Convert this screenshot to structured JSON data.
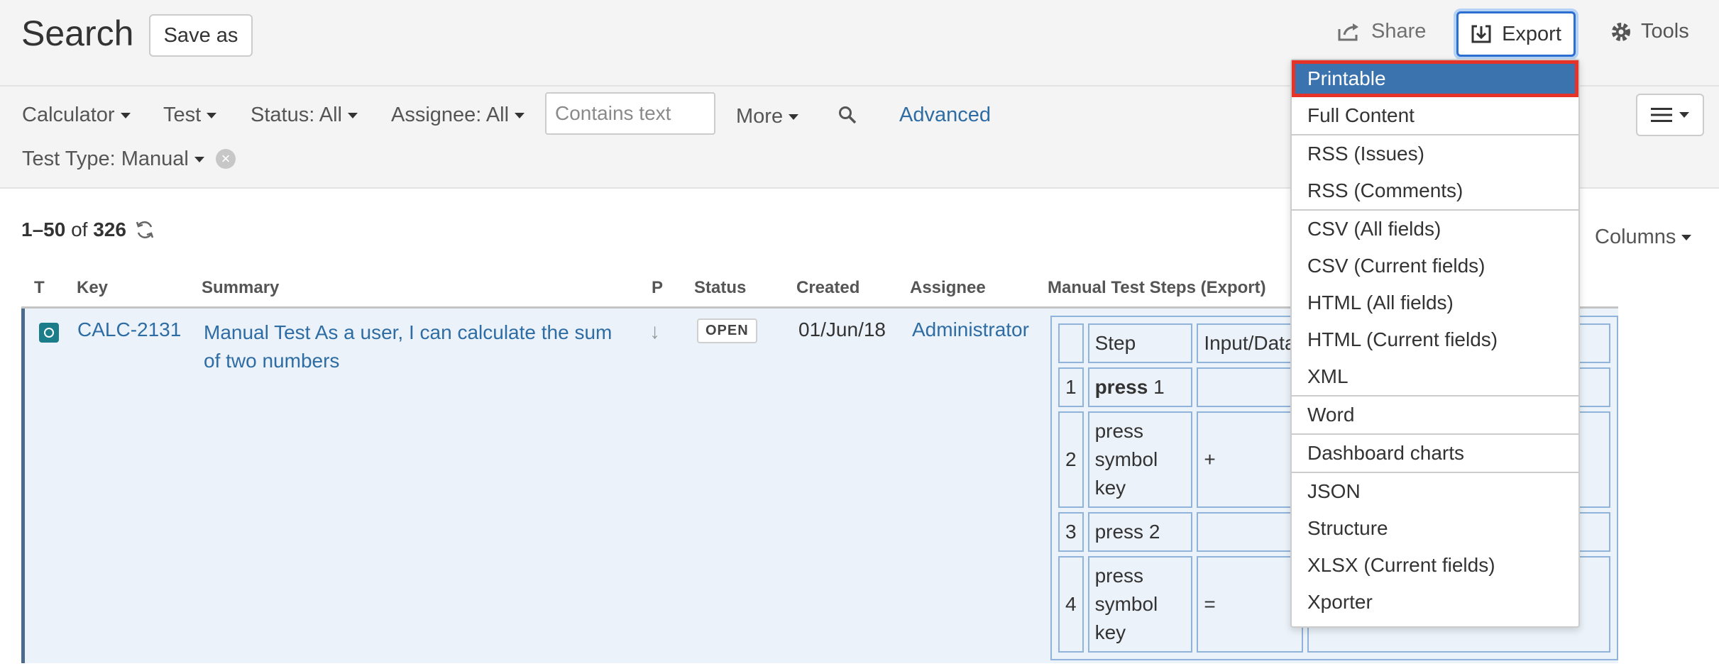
{
  "header": {
    "title": "Search",
    "save_as_label": "Save as",
    "share_label": "Share",
    "export_label": "Export",
    "tools_label": "Tools"
  },
  "filters": {
    "project": "Calculator",
    "type": "Test",
    "status": "Status: All",
    "assignee": "Assignee: All",
    "text_placeholder": "Contains text",
    "more": "More",
    "advanced": "Advanced",
    "test_type": "Test Type: Manual"
  },
  "results": {
    "range": "1–50",
    "of": "of",
    "total": "326",
    "columns_label": "Columns"
  },
  "table": {
    "headers": [
      "T",
      "Key",
      "Summary",
      "P",
      "Status",
      "Created",
      "Assignee",
      "Manual Test Steps (Export)"
    ],
    "row": {
      "key": "CALC-2131",
      "summary": "Manual Test As a user, I can calculate the sum of two numbers",
      "status": "OPEN",
      "created": "01/Jun/18",
      "assignee": "Administrator"
    },
    "steps": {
      "headers": [
        "Step",
        "Input/Data"
      ],
      "rows": [
        {
          "n": "1",
          "bold": "press",
          "rest": " 1",
          "data": ""
        },
        {
          "n": "2",
          "step": "press symbol key",
          "data": "+"
        },
        {
          "n": "3",
          "step": "press 2",
          "data": ""
        },
        {
          "n": "4",
          "step": "press symbol key",
          "data": "="
        }
      ]
    }
  },
  "export_menu": {
    "groups": [
      [
        "Printable",
        "Full Content"
      ],
      [
        "RSS (Issues)",
        "RSS (Comments)"
      ],
      [
        "CSV (All fields)",
        "CSV (Current fields)",
        "HTML (All fields)",
        "HTML (Current fields)",
        "XML"
      ],
      [
        "Word"
      ],
      [
        "Dashboard charts"
      ],
      [
        "JSON",
        "Structure",
        "XLSX (Current fields)",
        "Xporter"
      ]
    ]
  },
  "colors": {
    "link": "#2e6ca4",
    "menu_active": "#3b73af",
    "highlight_border": "#e5332a",
    "row_background": "#ebf2f9"
  }
}
